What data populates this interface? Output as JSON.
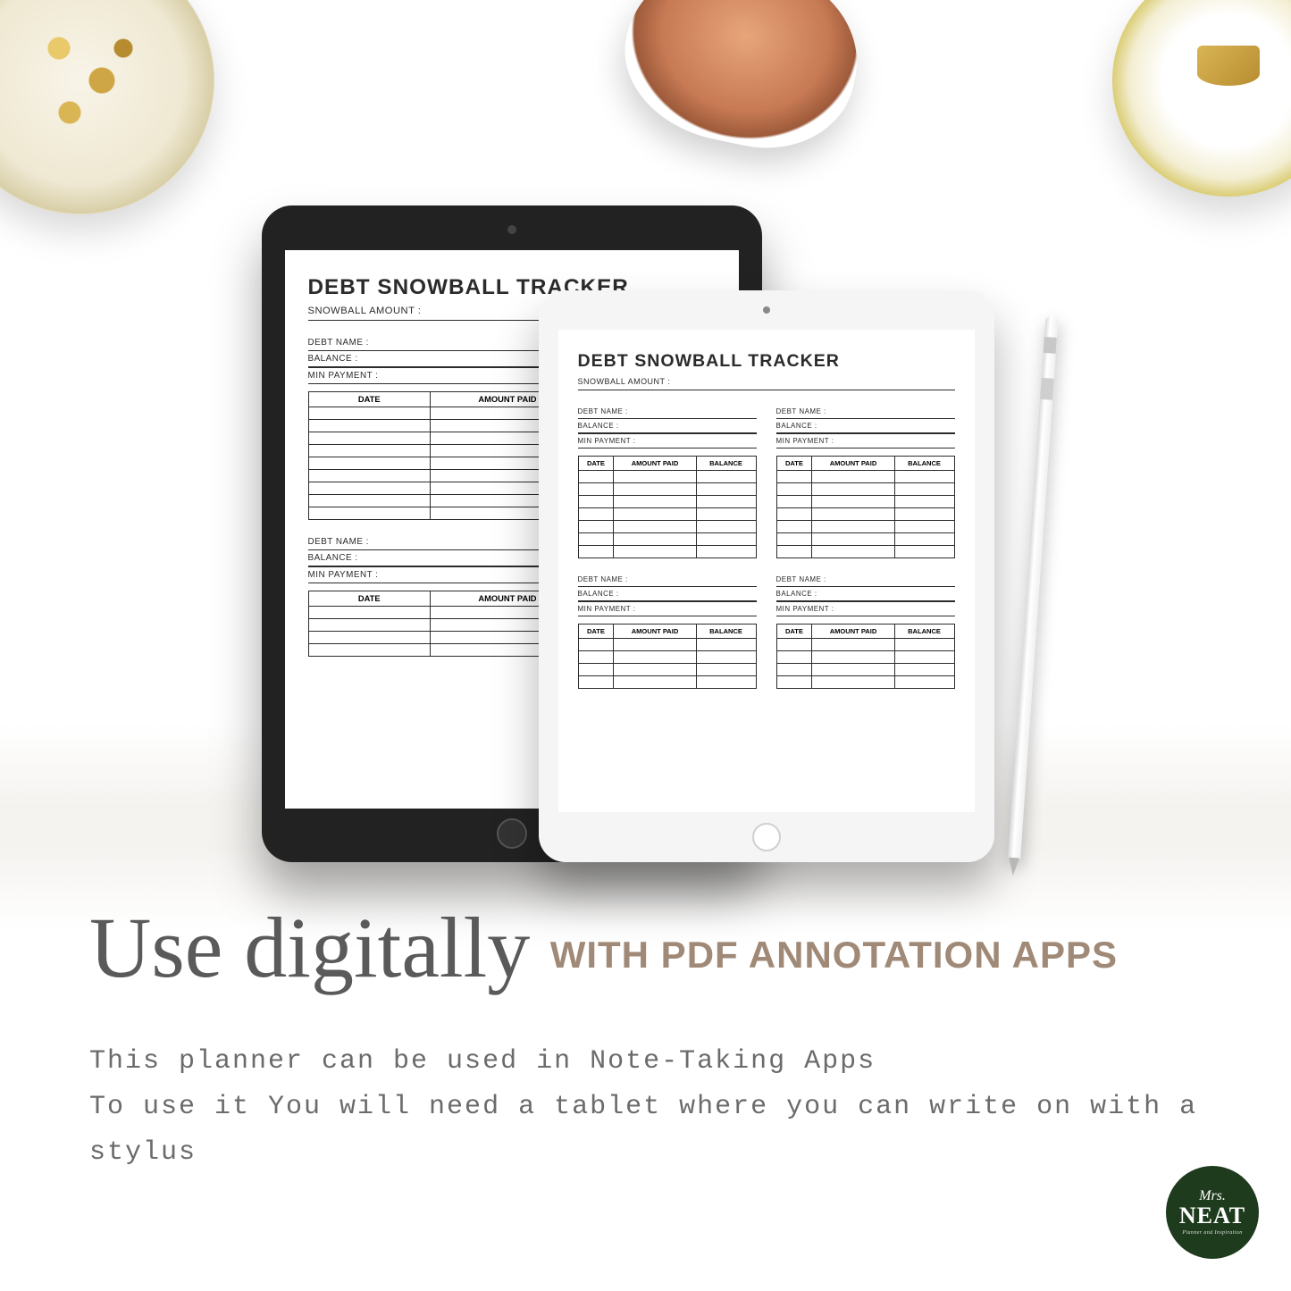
{
  "tracker": {
    "title": "DEBT SNOWBALL TRACKER",
    "subtitle": "SNOWBALL AMOUNT :",
    "fields": {
      "debt_name": "DEBT NAME :",
      "balance": "BALANCE :",
      "min_payment": "MIN PAYMENT :"
    },
    "columns": {
      "date": "DATE",
      "amount_paid": "AMOUNT PAID",
      "balance": "BALANCE"
    }
  },
  "headline": {
    "script": "Use digitally",
    "subhead": "WITH PDF ANNOTATION APPS",
    "body_line1": "This planner can be used in Note-Taking Apps",
    "body_line2": "To use it You will need a tablet where you can write on with a stylus"
  },
  "logo": {
    "line1": "Mrs.",
    "line2": "NEAT",
    "tagline": "Planner and Inspiration"
  }
}
